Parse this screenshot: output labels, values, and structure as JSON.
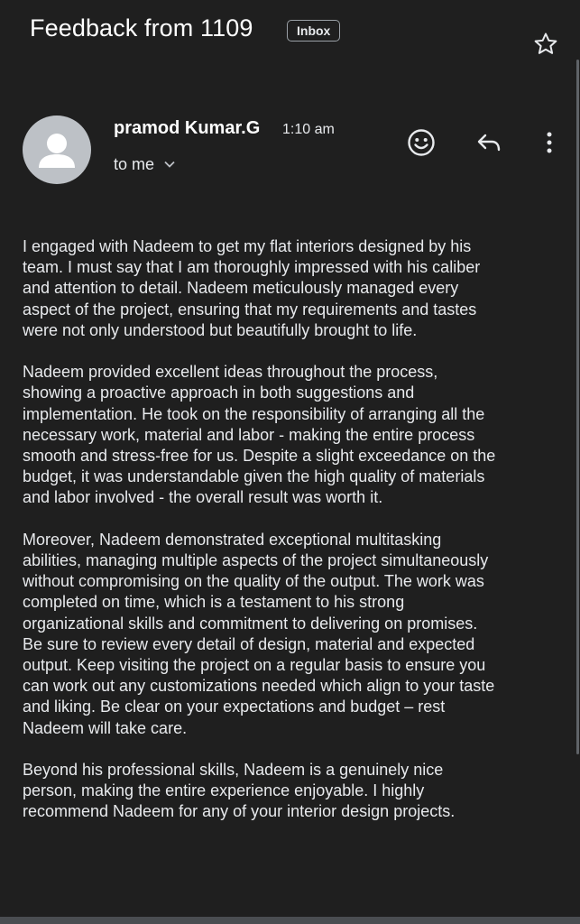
{
  "subject": "Feedback from 1109",
  "label": "Inbox",
  "sender": {
    "name": "pramod Kumar.G",
    "time": "1:10 am",
    "recipient": "to me"
  },
  "icons": {
    "star": "star-icon",
    "avatar": "person-avatar-icon",
    "emoji": "emoji-reaction-icon",
    "reply": "reply-icon",
    "more": "more-vertical-icon",
    "expand": "chevron-down-icon"
  },
  "colors": {
    "background": "#1f1f1f",
    "text": "#e8eaed",
    "avatar": "#bdc1c6"
  },
  "body": {
    "paragraphs": [
      "I engaged with Nadeem to get my flat interiors designed by his team. I must say that I am thoroughly impressed with his caliber and attention to detail. Nadeem meticulously managed every aspect of the project, ensuring that my requirements and tastes were not only understood but beautifully brought to life.",
      "Nadeem provided excellent ideas throughout the process, showing a proactive approach in both suggestions and implementation. He took on the responsibility of arranging all the necessary work, material and labor - making the entire process smooth and stress-free for us. Despite a slight exceedance on the budget, it was understandable given the high quality of materials and labor involved - the overall result was worth it.",
      "Moreover, Nadeem demonstrated exceptional multitasking abilities, managing multiple aspects of the project simultaneously without compromising on the quality of the output. The work was completed on time, which is a testament to his strong organizational skills and commitment to delivering on promises. Be sure to review every detail of design, material and expected output. Keep visiting the project on a regular basis to ensure you can work out any customizations needed which align to your taste and liking. Be clear on your expectations and budget – rest Nadeem will take care.",
      "Beyond his professional skills, Nadeem is a genuinely nice person, making the entire experience enjoyable. I highly recommend Nadeem for any of your interior design projects."
    ]
  }
}
